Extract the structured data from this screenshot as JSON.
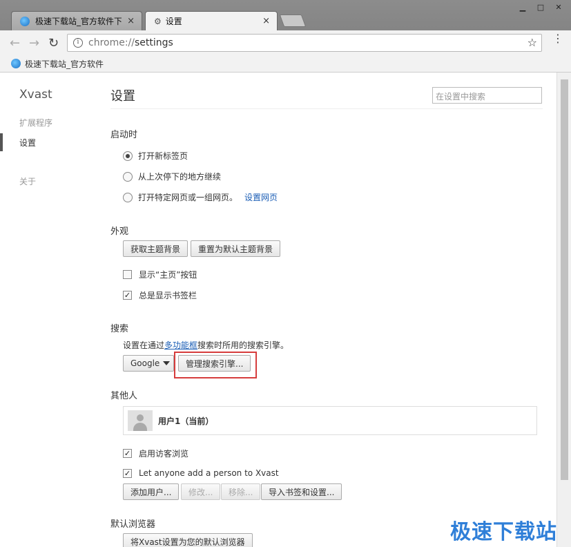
{
  "window": {
    "minimize": "▁",
    "maximize": "□",
    "close": "✕"
  },
  "tabs": [
    {
      "label": "极速下载站_官方软件下载",
      "close": "×"
    },
    {
      "label": "设置",
      "close": "×"
    }
  ],
  "toolbar": {
    "back": "←",
    "forward": "→",
    "reload": "↻",
    "url_scheme": "chrome://",
    "url_path": "settings",
    "info": "i",
    "star": "☆",
    "menu": "⋮"
  },
  "bookmarks": [
    {
      "label": "极速下载站_官方软件"
    }
  ],
  "sidebar": {
    "brand": "Xvast",
    "items": [
      {
        "label": "扩展程序"
      },
      {
        "label": "设置"
      },
      {
        "label": "关于"
      }
    ]
  },
  "header": {
    "title": "设置",
    "search_placeholder": "在设置中搜索"
  },
  "startup": {
    "title": "启动时",
    "options": [
      {
        "label": "打开新标签页",
        "selected": true
      },
      {
        "label": "从上次停下的地方继续",
        "selected": false
      },
      {
        "label": "打开特定网页或一组网页。",
        "selected": false
      }
    ],
    "link": "设置网页"
  },
  "appearance": {
    "title": "外观",
    "get_themes": "获取主题背景",
    "reset_theme": "重置为默认主题背景",
    "checks": [
      {
        "label": "显示“主页”按钮",
        "checked": false
      },
      {
        "label": "总是显示书签栏",
        "checked": true
      }
    ]
  },
  "search": {
    "title": "搜索",
    "note_prefix": "设置在通过",
    "note_link": "多功能框",
    "note_suffix": "搜索时所用的搜索引擎。",
    "engine": "Google",
    "manage": "管理搜索引擎..."
  },
  "people": {
    "title": "其他人",
    "user": "用户1（当前）",
    "checks": [
      {
        "label": "启用访客浏览",
        "checked": true
      },
      {
        "label": "Let anyone add a person to Xvast",
        "checked": true
      }
    ],
    "add": "添加用户...",
    "edit": "修改...",
    "remove": "移除...",
    "import": "导入书签和设置..."
  },
  "default_browser": {
    "title": "默认浏览器",
    "button": "将Xvast设置为您的默认浏览器"
  },
  "watermark": "极速下载站"
}
